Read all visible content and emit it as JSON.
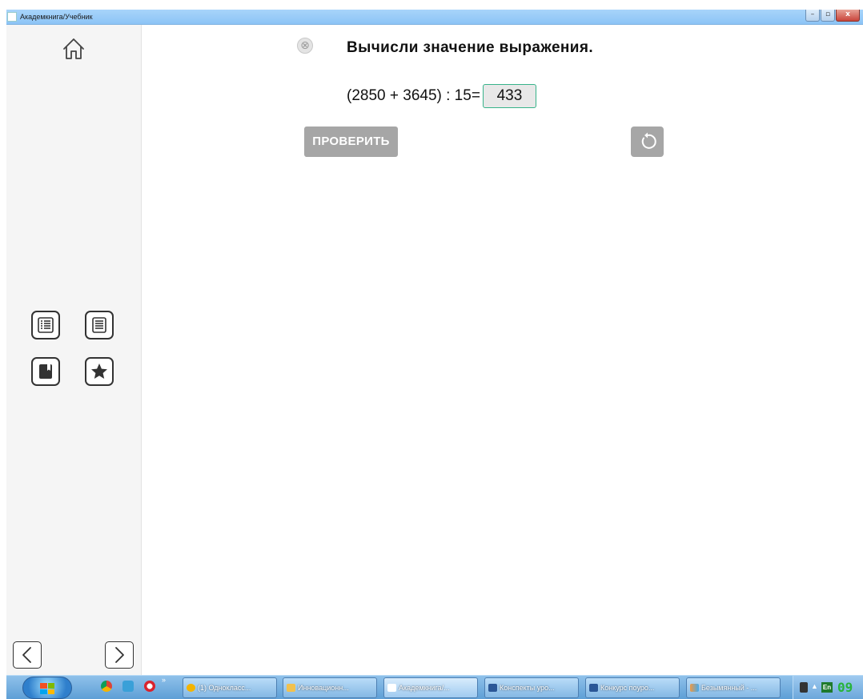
{
  "window": {
    "title": "Академкнига/Учебник",
    "controls": [
      "–",
      "▫",
      "x"
    ]
  },
  "sidebar": {
    "icons": [
      "home-icon",
      "table-of-contents-icon",
      "page-text-icon",
      "bookmark-icon",
      "star-icon",
      "chevron-left-icon",
      "chevron-right-icon"
    ]
  },
  "task": {
    "title": "Вычисли значение выражения.",
    "expression": "(2850 + 3645) : 15=",
    "answer": "433",
    "check_label": "ПРОВЕРИТЬ",
    "close_glyph": "⊗"
  },
  "colors": {
    "answer_border": "#37b38a",
    "button_gray": "#a6a6a6",
    "sidebar_bg": "#f5f5f5"
  },
  "taskbar": {
    "overflow_glyph": "»",
    "items": [
      {
        "label": "(1) Однокласс..."
      },
      {
        "label": "Инновационн..."
      },
      {
        "label": "Академкнига/..."
      },
      {
        "label": "Конспекты уро..."
      },
      {
        "label": "Конкурс поуро..."
      },
      {
        "label": "Безымянный - ..."
      }
    ],
    "tray": {
      "lang": "En",
      "clock": "09"
    }
  }
}
